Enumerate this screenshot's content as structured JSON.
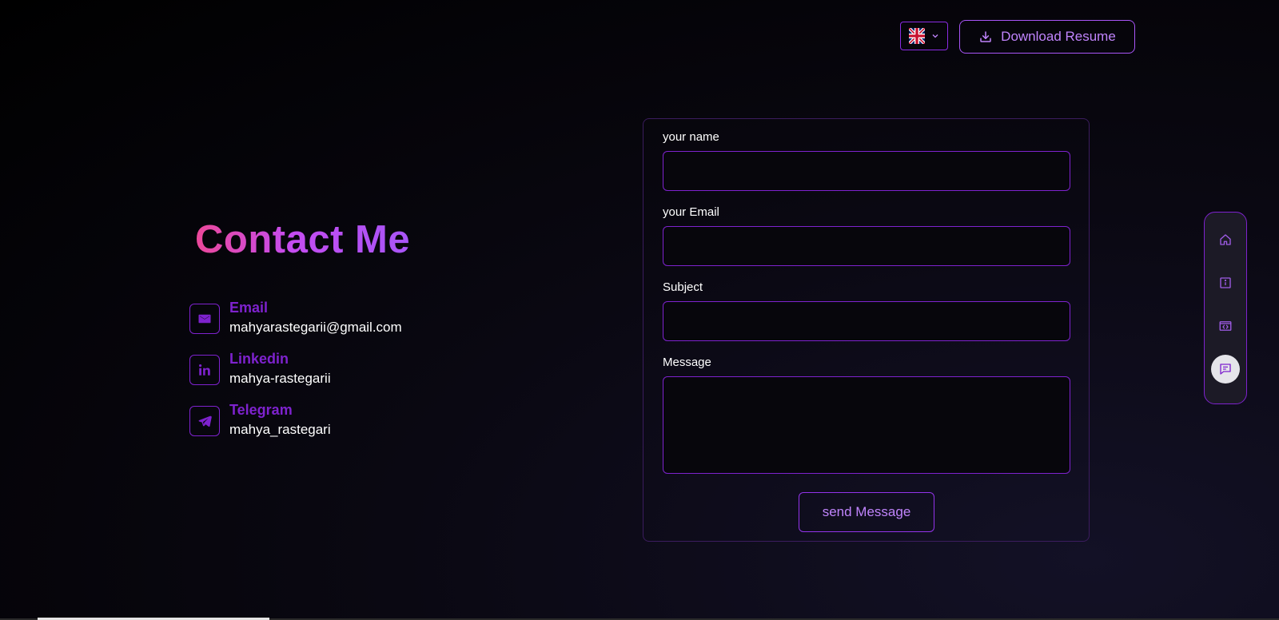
{
  "header": {
    "language": {
      "icon": "uk-flag-icon",
      "dropdown_icon": "chevron-down-icon"
    },
    "download_resume_label": "Download Resume"
  },
  "contact": {
    "heading": "Contact Me",
    "items": [
      {
        "title": "Email",
        "value": "mahyarastegarii@gmail.com",
        "icon": "mail-icon"
      },
      {
        "title": "Linkedin",
        "value": "mahya-rastegarii",
        "icon": "linkedin-icon"
      },
      {
        "title": "Telegram",
        "value": "mahya_rastegari",
        "icon": "telegram-icon"
      }
    ]
  },
  "form": {
    "name_label": "your name",
    "email_label": "your Email",
    "subject_label": "Subject",
    "message_label": "Message",
    "name_value": "",
    "email_value": "",
    "subject_value": "",
    "message_value": "",
    "send_label": "send Message"
  },
  "side_nav": {
    "items": [
      {
        "name": "home",
        "icon": "home-icon",
        "active": false
      },
      {
        "name": "about",
        "icon": "info-icon",
        "active": false
      },
      {
        "name": "projects",
        "icon": "code-icon",
        "active": false
      },
      {
        "name": "contact",
        "icon": "message-icon",
        "active": true
      }
    ]
  },
  "colors": {
    "accent": "#7e22ce",
    "accent_light": "#c084fc",
    "heading_gradient_start": "#ec4899",
    "heading_gradient_end": "#a855f7",
    "background": "#000000"
  }
}
